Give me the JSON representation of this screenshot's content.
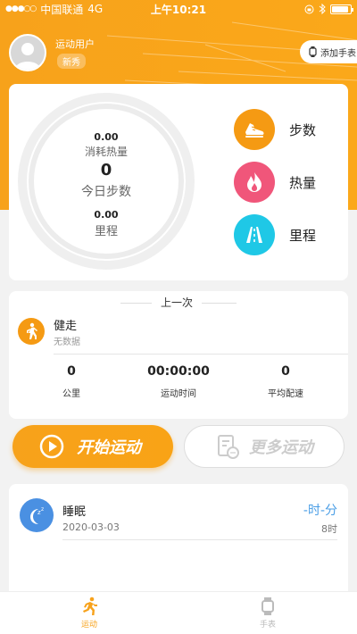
{
  "status_bar": {
    "carrier": "中国联通",
    "network": "4G",
    "time": "上午10:21",
    "battery_level": 0.9
  },
  "user": {
    "name": "运动用户",
    "level": "新秀"
  },
  "add_watch": {
    "label": "添加手表"
  },
  "today": {
    "calories_value": "0.00",
    "calories_label": "消耗热量",
    "steps_value": "0",
    "steps_label": "今日步数",
    "distance_value": "0.00",
    "distance_label": "里程"
  },
  "metrics": [
    {
      "label": "步数",
      "icon": "sneaker-icon",
      "color": "#f59a13"
    },
    {
      "label": "热量",
      "icon": "flame-icon",
      "color": "#f0567a"
    },
    {
      "label": "里程",
      "icon": "road-icon",
      "color": "#1fc8e6"
    }
  ],
  "last_session": {
    "title": "上一次",
    "activity": "健走",
    "status": "无数据",
    "stats": [
      {
        "value": "0",
        "label": "公里"
      },
      {
        "value": "00:00:00",
        "label": "运动时间"
      },
      {
        "value": "0",
        "label": "平均配速"
      }
    ]
  },
  "actions": {
    "start_label": "开始运动",
    "more_label": "更多运动"
  },
  "sleep": {
    "title": "睡眠",
    "date": "2020-03-03",
    "duration": "-时-分",
    "hour_label": "8时"
  },
  "tabs": [
    {
      "label": "运动",
      "active": true
    },
    {
      "label": "手表",
      "active": false
    }
  ],
  "colors": {
    "brand": "#f7a21b",
    "inactive_tab": "#bbbbbb",
    "sleep_blue": "#4a9ee6"
  }
}
